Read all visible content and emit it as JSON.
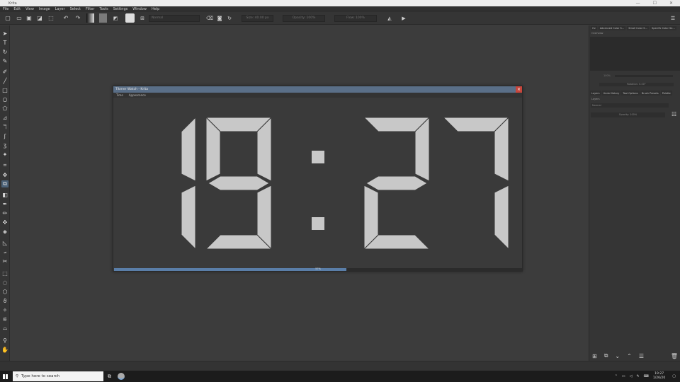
{
  "app": {
    "title": "Krita",
    "window_controls": [
      "—",
      "☐",
      "✕"
    ]
  },
  "menu": [
    "File",
    "Edit",
    "View",
    "Image",
    "Layer",
    "Select",
    "Filter",
    "Tools",
    "Settings",
    "Window",
    "Help"
  ],
  "toolbar": {
    "blend_mode": "Normal",
    "size": "Size: 40.00 px",
    "opacity": "Opacity: 100%",
    "flow": "Flow: 100%"
  },
  "dock": {
    "top_tabs": [
      "Ov",
      "Advanced Color S…",
      "Small Color S…",
      "Specific Color Se…"
    ],
    "overview_label": "Overview",
    "zoom_value": "100%",
    "rotation": "Rotation: 0.00°",
    "tabs": [
      "Layers",
      "Undo History",
      "Tool Options",
      "Brush Presets",
      "Palette"
    ],
    "layers_label": "Layers",
    "blend": "Normal",
    "opacity": "Opacity: 100%"
  },
  "dialog": {
    "title": "Tikmer Watch - Krita",
    "menu": [
      "Time",
      "Appearance"
    ],
    "digits": {
      "h1": "1",
      "h2": "9",
      "m1": "2",
      "m2": "7"
    },
    "progress_percent": 57,
    "progress_label": "57%",
    "colors": {
      "segment": "#c8c8c8",
      "bg": "#3a3a3a"
    }
  },
  "taskbar": {
    "search_placeholder": "Type here to search",
    "time": "19:27",
    "date": "1/26/20"
  }
}
